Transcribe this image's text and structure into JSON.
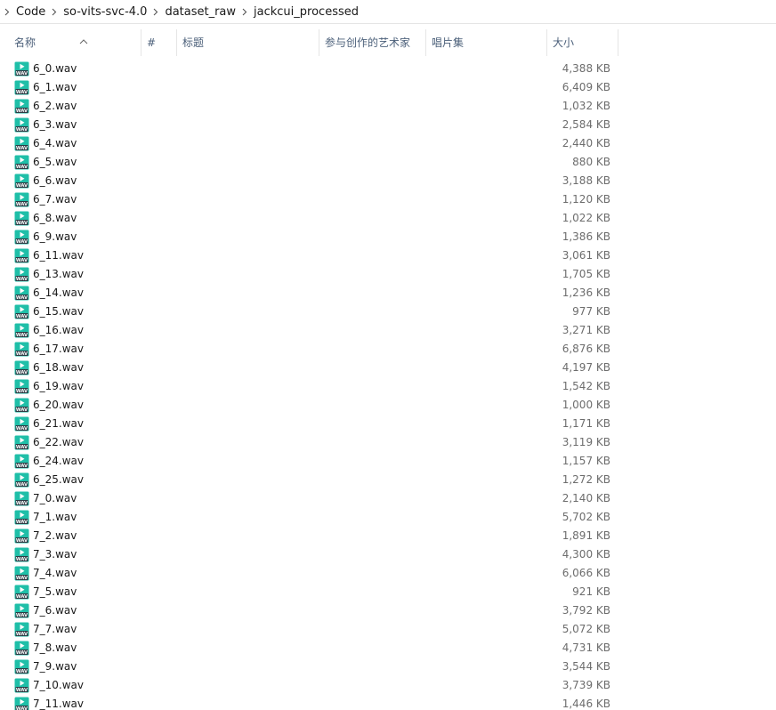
{
  "breadcrumb": {
    "items": [
      "Code",
      "so-vits-svc-4.0",
      "dataset_raw",
      "jackcui_processed"
    ]
  },
  "columns": {
    "name": "名称",
    "number": "#",
    "title": "标题",
    "artists": "参与创作的艺术家",
    "album": "唱片集",
    "size": "大小"
  },
  "icons": {
    "file": "wav-audio-file-icon",
    "separator": "chevron-right-icon",
    "sort": "sort-ascending-arrow-icon"
  },
  "colors": {
    "icon_teal": "#1fbfa8",
    "header_text": "#4c607a",
    "size_text": "#6d6d6d"
  },
  "files": [
    {
      "name": "6_0.wav",
      "size": "4,388 KB"
    },
    {
      "name": "6_1.wav",
      "size": "6,409 KB"
    },
    {
      "name": "6_2.wav",
      "size": "1,032 KB"
    },
    {
      "name": "6_3.wav",
      "size": "2,584 KB"
    },
    {
      "name": "6_4.wav",
      "size": "2,440 KB"
    },
    {
      "name": "6_5.wav",
      "size": "880 KB"
    },
    {
      "name": "6_6.wav",
      "size": "3,188 KB"
    },
    {
      "name": "6_7.wav",
      "size": "1,120 KB"
    },
    {
      "name": "6_8.wav",
      "size": "1,022 KB"
    },
    {
      "name": "6_9.wav",
      "size": "1,386 KB"
    },
    {
      "name": "6_11.wav",
      "size": "3,061 KB"
    },
    {
      "name": "6_13.wav",
      "size": "1,705 KB"
    },
    {
      "name": "6_14.wav",
      "size": "1,236 KB"
    },
    {
      "name": "6_15.wav",
      "size": "977 KB"
    },
    {
      "name": "6_16.wav",
      "size": "3,271 KB"
    },
    {
      "name": "6_17.wav",
      "size": "6,876 KB"
    },
    {
      "name": "6_18.wav",
      "size": "4,197 KB"
    },
    {
      "name": "6_19.wav",
      "size": "1,542 KB"
    },
    {
      "name": "6_20.wav",
      "size": "1,000 KB"
    },
    {
      "name": "6_21.wav",
      "size": "1,171 KB"
    },
    {
      "name": "6_22.wav",
      "size": "3,119 KB"
    },
    {
      "name": "6_24.wav",
      "size": "1,157 KB"
    },
    {
      "name": "6_25.wav",
      "size": "1,272 KB"
    },
    {
      "name": "7_0.wav",
      "size": "2,140 KB"
    },
    {
      "name": "7_1.wav",
      "size": "5,702 KB"
    },
    {
      "name": "7_2.wav",
      "size": "1,891 KB"
    },
    {
      "name": "7_3.wav",
      "size": "4,300 KB"
    },
    {
      "name": "7_4.wav",
      "size": "6,066 KB"
    },
    {
      "name": "7_5.wav",
      "size": "921 KB"
    },
    {
      "name": "7_6.wav",
      "size": "3,792 KB"
    },
    {
      "name": "7_7.wav",
      "size": "5,072 KB"
    },
    {
      "name": "7_8.wav",
      "size": "4,731 KB"
    },
    {
      "name": "7_9.wav",
      "size": "3,544 KB"
    },
    {
      "name": "7_10.wav",
      "size": "3,739 KB"
    },
    {
      "name": "7_11.wav",
      "size": "1,446 KB"
    }
  ]
}
